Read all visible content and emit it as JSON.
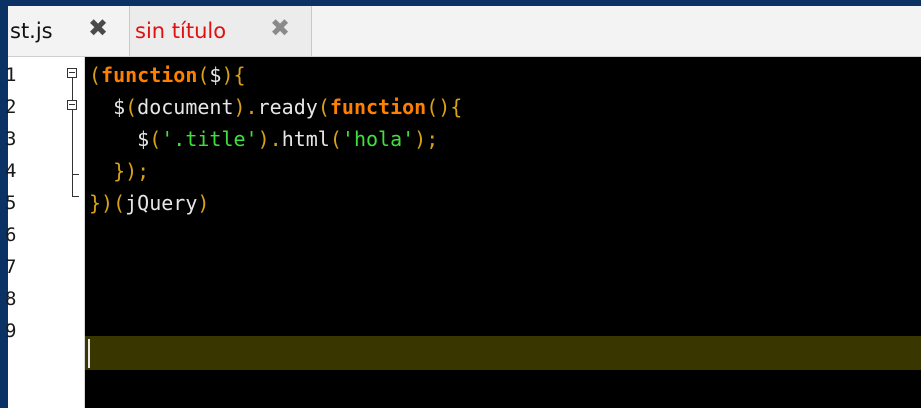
{
  "tabs": [
    {
      "label": "st.js",
      "close_glyph": "✖",
      "active": true
    },
    {
      "label": "sin título",
      "close_glyph": "✖",
      "active": false
    }
  ],
  "gutter": {
    "line_numbers": [
      "1",
      "2",
      "3",
      "4",
      "5",
      "6",
      "7",
      "8",
      "9"
    ]
  },
  "code": {
    "lines": [
      [
        {
          "t": "(",
          "c": "p"
        },
        {
          "t": "function",
          "c": "kw"
        },
        {
          "t": "(",
          "c": "p"
        },
        {
          "t": "$",
          "c": "id"
        },
        {
          "t": "){",
          "c": "p"
        }
      ],
      [
        {
          "t": "  $",
          "c": "id"
        },
        {
          "t": "(",
          "c": "p"
        },
        {
          "t": "document",
          "c": "id"
        },
        {
          "t": ").",
          "c": "p"
        },
        {
          "t": "ready",
          "c": "id"
        },
        {
          "t": "(",
          "c": "p"
        },
        {
          "t": "function",
          "c": "kw"
        },
        {
          "t": "(){",
          "c": "p"
        }
      ],
      [
        {
          "t": "    $",
          "c": "id"
        },
        {
          "t": "(",
          "c": "p"
        },
        {
          "t": "'.title'",
          "c": "str"
        },
        {
          "t": ").",
          "c": "p"
        },
        {
          "t": "html",
          "c": "id"
        },
        {
          "t": "(",
          "c": "p"
        },
        {
          "t": "'hola'",
          "c": "str"
        },
        {
          "t": ");",
          "c": "p"
        }
      ],
      [
        {
          "t": "  });",
          "c": "p"
        }
      ],
      [
        {
          "t": "})(",
          "c": "p"
        },
        {
          "t": "jQuery",
          "c": "id"
        },
        {
          "t": ")",
          "c": "p"
        }
      ],
      [],
      [],
      [],
      []
    ]
  },
  "colors": {
    "background_frame": "#0b3264",
    "editor_background": "#000000",
    "current_line": "#3a3600",
    "keyword": "#ff7f00",
    "punctuation": "#d7a21a",
    "identifier": "#e6e6e6",
    "string": "#3ee03e",
    "inactive_tab_label": "#e01010"
  }
}
